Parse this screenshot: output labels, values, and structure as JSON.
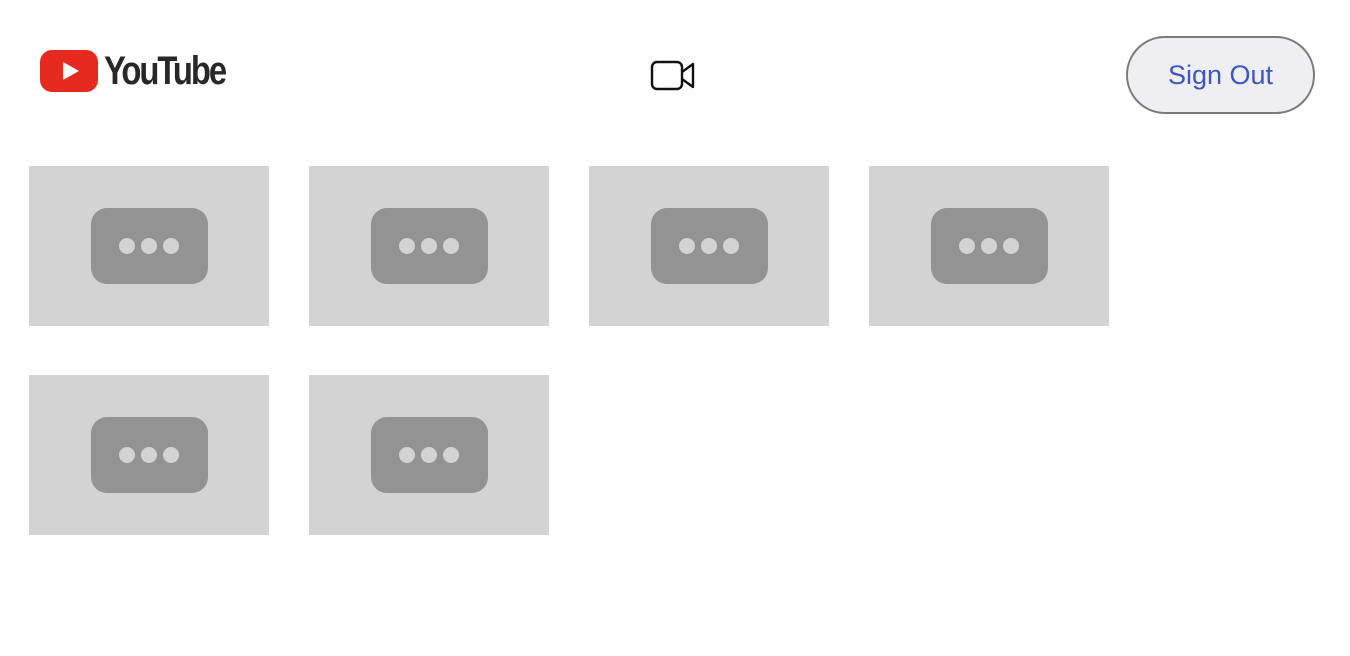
{
  "header": {
    "logo_text": "YouTube",
    "logo_icon": "youtube-play-icon",
    "camera_icon": "video-camera-icon",
    "signout_label": "Sign Out"
  },
  "colors": {
    "brand_red": "#e62b1e",
    "logo_text": "#282828",
    "signout_text": "#3c57c2",
    "signout_bg": "#efeff1",
    "tile_bg": "#d3d3d3",
    "placeholder_icon": "#939393"
  },
  "videos": [
    {
      "icon": "more-dots-placeholder-icon"
    },
    {
      "icon": "more-dots-placeholder-icon"
    },
    {
      "icon": "more-dots-placeholder-icon"
    },
    {
      "icon": "more-dots-placeholder-icon"
    },
    {
      "icon": "more-dots-placeholder-icon"
    },
    {
      "icon": "more-dots-placeholder-icon"
    }
  ]
}
